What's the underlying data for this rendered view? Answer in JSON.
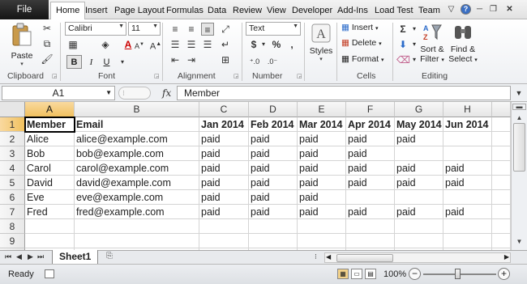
{
  "ribbon_tabs": [
    {
      "label": "File"
    },
    {
      "label": "Home",
      "active": true
    },
    {
      "label": "Insert"
    },
    {
      "label": "Page Layout"
    },
    {
      "label": "Formulas"
    },
    {
      "label": "Data"
    },
    {
      "label": "Review"
    },
    {
      "label": "View"
    },
    {
      "label": "Developer"
    },
    {
      "label": "Add-Ins"
    },
    {
      "label": "Load Test"
    },
    {
      "label": "Team"
    }
  ],
  "groups": {
    "clipboard": {
      "label": "Clipboard",
      "paste": "Paste"
    },
    "font": {
      "label": "Font",
      "font_name": "Calibri",
      "font_size": "11",
      "bold": "B",
      "italic": "I",
      "underline": "U",
      "font_color_letter": "A"
    },
    "alignment": {
      "label": "Alignment"
    },
    "number": {
      "label": "Number",
      "format": "Text",
      "currency": "$",
      "percent": "%",
      "comma": ","
    },
    "styles": {
      "label": "Styles"
    },
    "cells": {
      "label": "Cells",
      "insert": "Insert",
      "delete": "Delete",
      "format": "Format"
    },
    "editing": {
      "label": "Editing",
      "sort": "Sort &",
      "filter": "Filter",
      "find": "Find &",
      "select": "Select"
    }
  },
  "formula_bar": {
    "name_box": "A1",
    "fx": "fx",
    "formula": "Member"
  },
  "columns": [
    "A",
    "B",
    "C",
    "D",
    "E",
    "F",
    "G",
    "H"
  ],
  "rows": [
    "1",
    "2",
    "3",
    "4",
    "5",
    "6",
    "7",
    "8",
    "9",
    "10"
  ],
  "table": {
    "header": [
      "Member",
      "Email",
      "Jan 2014",
      "Feb 2014",
      "Mar 2014",
      "Apr 2014",
      "May 2014",
      "Jun 2014"
    ],
    "data": [
      [
        "Alice",
        "alice@example.com",
        "paid",
        "paid",
        "paid",
        "paid",
        "paid",
        ""
      ],
      [
        "Bob",
        "bob@example.com",
        "paid",
        "paid",
        "paid",
        "paid",
        "",
        ""
      ],
      [
        "Carol",
        "carol@example.com",
        "paid",
        "paid",
        "paid",
        "paid",
        "paid",
        "paid"
      ],
      [
        "David",
        "david@example.com",
        "paid",
        "paid",
        "paid",
        "paid",
        "paid",
        "paid"
      ],
      [
        "Eve",
        "eve@example.com",
        "paid",
        "paid",
        "paid",
        "",
        "",
        ""
      ],
      [
        "Fred",
        "fred@example.com",
        "paid",
        "paid",
        "paid",
        "paid",
        "paid",
        "paid"
      ]
    ]
  },
  "sheet_tabs": [
    {
      "label": "Sheet1",
      "active": true
    }
  ],
  "status": {
    "ready": "Ready",
    "zoom": "100%",
    "zoom_fraction": 0.5
  }
}
